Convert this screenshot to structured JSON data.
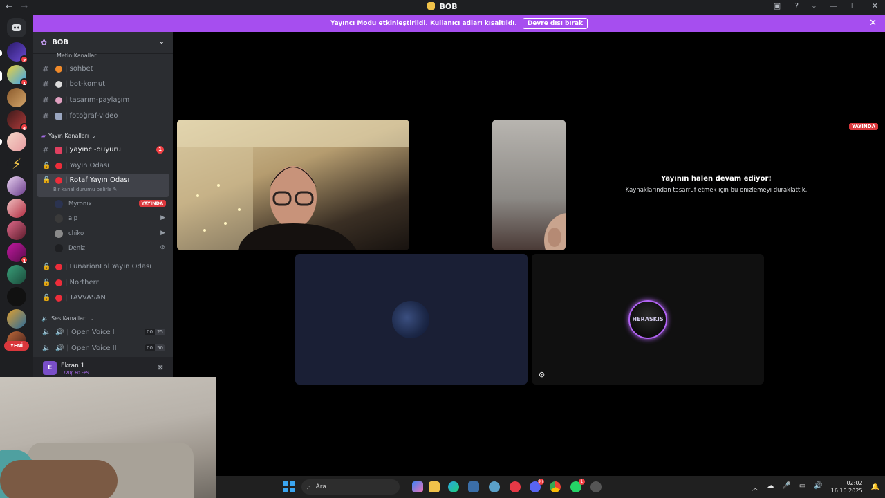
{
  "window": {
    "title": "BOB",
    "nav_back": "←",
    "nav_forward": "→"
  },
  "banner": {
    "text": "Yayıncı Modu etkinleştirildi. Kullanıcı adları kısaltıldı.",
    "button": "Devre dışı bırak",
    "close": "✕"
  },
  "rail": {
    "new_label": "YENİ",
    "badges": [
      "2",
      "1",
      "4",
      "1"
    ]
  },
  "server": {
    "name": "BOB",
    "chevron": "⌄"
  },
  "categories": {
    "text": "Metin Kanalları",
    "stream": "Yayın Kanalları",
    "voice": "Ses Kanalları"
  },
  "text_channels": [
    {
      "name": "| sohbet"
    },
    {
      "name": "| bot-komut"
    },
    {
      "name": "| tasarım-paylaşım"
    },
    {
      "name": "| fotoğraf-video"
    }
  ],
  "stream_channels": {
    "announce": {
      "name": "| yayıncı-duyuru",
      "mention": "1"
    },
    "room1": "| Yayın Odası",
    "room2": "| Rotaf Yayın Odası",
    "room2_status": "Bir kanal durumu belirle",
    "room3": "| LunarionLol Yayın Odası",
    "room4": "| Northerr",
    "room5": "| TAVVASAN"
  },
  "voice_users": [
    {
      "name": "Myronix",
      "tag": "YAYINDA"
    },
    {
      "name": "alp"
    },
    {
      "name": "chiko"
    },
    {
      "name": "Deniz"
    }
  ],
  "voice_channels": [
    {
      "name": "| Open Voice I",
      "count": "00",
      "limit": "25"
    },
    {
      "name": "| Open Voice II",
      "count": "00",
      "limit": "50"
    }
  ],
  "stream_panel": {
    "avatar": "E",
    "title": "Ekran 1",
    "subtitle": "720p 60 FPS"
  },
  "stage": {
    "live_badge": "YAYINDA",
    "live_title": "Yayının halen devam ediyor!",
    "live_subtitle": "Kaynaklarından tasarruf etmek için bu önizlemeyi duraklattık.",
    "avatar_b_text": "HERASKIS"
  },
  "taskbar": {
    "search_placeholder": "Ara",
    "time": "02:02",
    "date": "16.10.2025",
    "app_badges": [
      "9+",
      "1"
    ]
  },
  "colors": {
    "banner": "#a64eef",
    "live": "#da373c",
    "sidebar": "#2b2d31",
    "rail": "#1e1f22"
  }
}
